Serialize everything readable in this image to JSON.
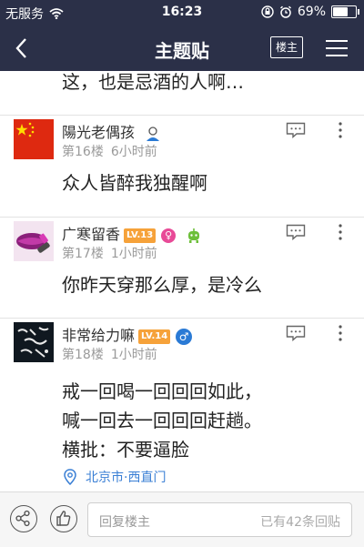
{
  "status_bar": {
    "carrier": "无服务",
    "time": "16:23",
    "battery": "69%",
    "battery_level": 0.69,
    "icons": [
      "wifi-icon",
      "orientation-lock-icon",
      "alarm-icon",
      "battery-icon"
    ]
  },
  "nav": {
    "title": "主题贴",
    "louzhu_label": "楼主",
    "icons": [
      "back-icon",
      "menu-icon"
    ]
  },
  "previous_post_tail": "这，也是忌酒的人啊…",
  "posts": [
    {
      "username": "陽光老偶孩",
      "floor": "第16楼",
      "time": "6小时前",
      "text_lines": [
        "众人皆醉我独醒啊"
      ],
      "avatar": "china-flag-avatar",
      "badges": [
        "user-badge-icon"
      ]
    },
    {
      "username": "广寒留香",
      "level": "LV.13",
      "gender_symbol": "♀",
      "floor": "第17楼",
      "time": "1小时前",
      "text_lines": [
        "你昨天穿那么厚，是冷么"
      ],
      "avatar": "lips-avatar",
      "badges": [
        "female-icon",
        "robot-badge-icon"
      ]
    },
    {
      "username": "非常给力嘛",
      "level": "LV.14",
      "gender_symbol": "♂",
      "floor": "第18楼",
      "time": "1小时前",
      "text_lines": [
        "戒一回喝一回回回如此，",
        "喊一回去一回回回赶趟。",
        "横批：不要逼脸"
      ],
      "location": "北京市·西直门",
      "avatar": "dark-text-avatar",
      "badges": [
        "male-icon"
      ]
    }
  ],
  "bottom_bar": {
    "reply_placeholder": "回复楼主",
    "reply_count": "已有42条回贴",
    "icons": [
      "share-icon",
      "like-icon"
    ]
  },
  "colors": {
    "nav_bg": "#2b3048",
    "level_badge": "#f6a23a",
    "female": "#e84a97",
    "male": "#2a7ad5",
    "location": "#3a7fd5"
  }
}
